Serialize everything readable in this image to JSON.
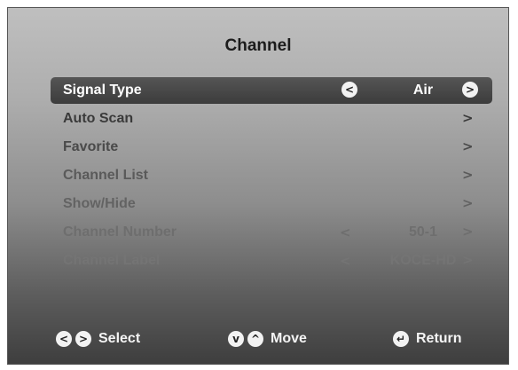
{
  "menu": {
    "title": "Channel",
    "rows": [
      {
        "label": "Signal Type",
        "value": "Air",
        "left_arrow": "<",
        "right_arrow": ">"
      },
      {
        "label": "Auto Scan",
        "right_arrow": ">"
      },
      {
        "label": "Favorite",
        "right_arrow": ">"
      },
      {
        "label": "Channel List",
        "right_arrow": ">"
      },
      {
        "label": "Show/Hide",
        "right_arrow": ">"
      },
      {
        "label": "Channel Number",
        "value": "50-1",
        "left_arrow": "<",
        "right_arrow": ">"
      },
      {
        "label": "Channel Label",
        "value": "KOCE-HD",
        "left_arrow": "<",
        "right_arrow": ">"
      }
    ]
  },
  "footer": {
    "select_label": "Select",
    "move_label": "Move",
    "return_label": "Return",
    "select_icons": [
      "<",
      ">"
    ],
    "move_icons": [
      "v",
      "^"
    ],
    "return_icon": "↵"
  },
  "icons": {
    "left": "left-arrow-icon",
    "right": "right-arrow-icon",
    "up": "up-arrow-icon",
    "down": "down-arrow-icon",
    "return": "return-icon"
  },
  "colors": {
    "selected_bar": "#3c3c3c",
    "selected_text": "#ffffff",
    "footer_text": "#f4f4f4"
  }
}
